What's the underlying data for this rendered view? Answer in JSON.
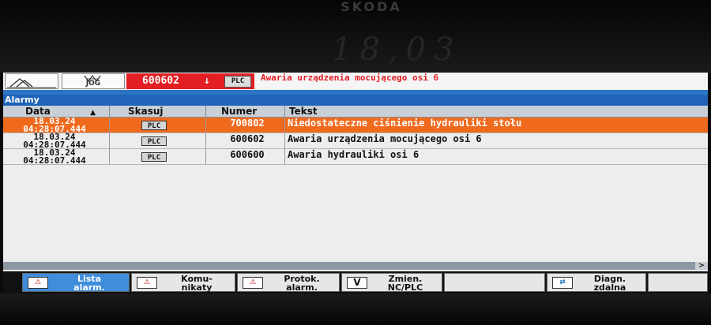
{
  "bezel": {
    "brand": "SKODA",
    "reflection_text": "18,03"
  },
  "header": {
    "mode_label": "JOG",
    "active_alarm_number": "600602",
    "active_alarm_arrow": "↓",
    "active_alarm_source": "PLC",
    "active_alarm_text": "Awaria urządzenia mocującego osi 6"
  },
  "window_title": "Alarmy",
  "table": {
    "columns": {
      "date": "Data",
      "sort_indicator": "▲",
      "clear": "Skasuj",
      "number": "Numer",
      "text": "Tekst"
    },
    "rows": [
      {
        "date": "18.03.24",
        "time": "04:28:07.444",
        "clear": "PLC",
        "number": "700802",
        "text": "Niedostateczne ciśnienie hydrauliki stołu",
        "selected": true
      },
      {
        "date": "18.03.24",
        "time": "04:28:07.444",
        "clear": "PLC",
        "number": "600602",
        "text": "Awaria urządzenia mocującego osi 6",
        "selected": false
      },
      {
        "date": "18.03.24",
        "time": "04:28:07.444",
        "clear": "PLC",
        "number": "600600",
        "text": "Awaria hydrauliki osi 6",
        "selected": false
      }
    ]
  },
  "scroll_arrow": ">",
  "softkeys": [
    {
      "line1": "Lista",
      "line2": "alarm.",
      "icon": "alarm-list-icon",
      "icon_text": "⚠",
      "active": true
    },
    {
      "line1": "Komu-",
      "line2": "nikaty",
      "icon": "message-icon",
      "icon_text": "⚠",
      "active": false
    },
    {
      "line1": "Protok.",
      "line2": "alarm.",
      "icon": "alarm-log-icon",
      "icon_text": "⚠",
      "active": false
    },
    {
      "line1": "Zmien.",
      "line2": "NC/PLC",
      "icon": "variable-change-icon",
      "icon_text": "V",
      "active": false
    },
    {
      "line1": "",
      "line2": "",
      "icon": "",
      "icon_text": "",
      "active": false
    },
    {
      "line1": "Diagn.",
      "line2": "zdalna",
      "icon": "remote-diagnosis-icon",
      "icon_text": "⇄",
      "active": false
    }
  ]
}
